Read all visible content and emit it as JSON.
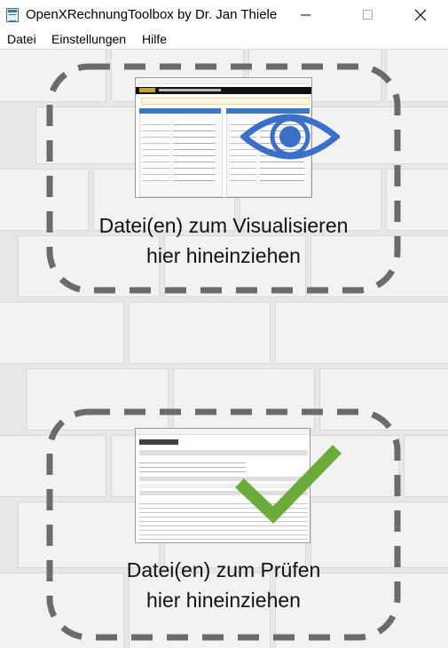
{
  "window": {
    "title": "OpenXRechnungToolbox by Dr. Jan Thiele",
    "minimize_icon": "minimize-icon",
    "maximize_icon": "maximize-icon",
    "close_icon": "close-icon"
  },
  "menu": {
    "items": [
      "Datei",
      "Einstellungen",
      "Hilfe"
    ]
  },
  "dropzones": {
    "visualize": {
      "line1": "Datei(en) zum Visualisieren",
      "line2": "hier hineinziehen",
      "icon": "eye-icon",
      "icon_color": "#3b6fc8"
    },
    "validate": {
      "line1": "Datei(en) zum Prüfen",
      "line2": "hier hineinziehen",
      "icon": "checkmark-icon",
      "icon_color": "#6aab3a"
    }
  },
  "colors": {
    "dash_border": "#6b6b6b",
    "background": "#e7e7e7"
  }
}
